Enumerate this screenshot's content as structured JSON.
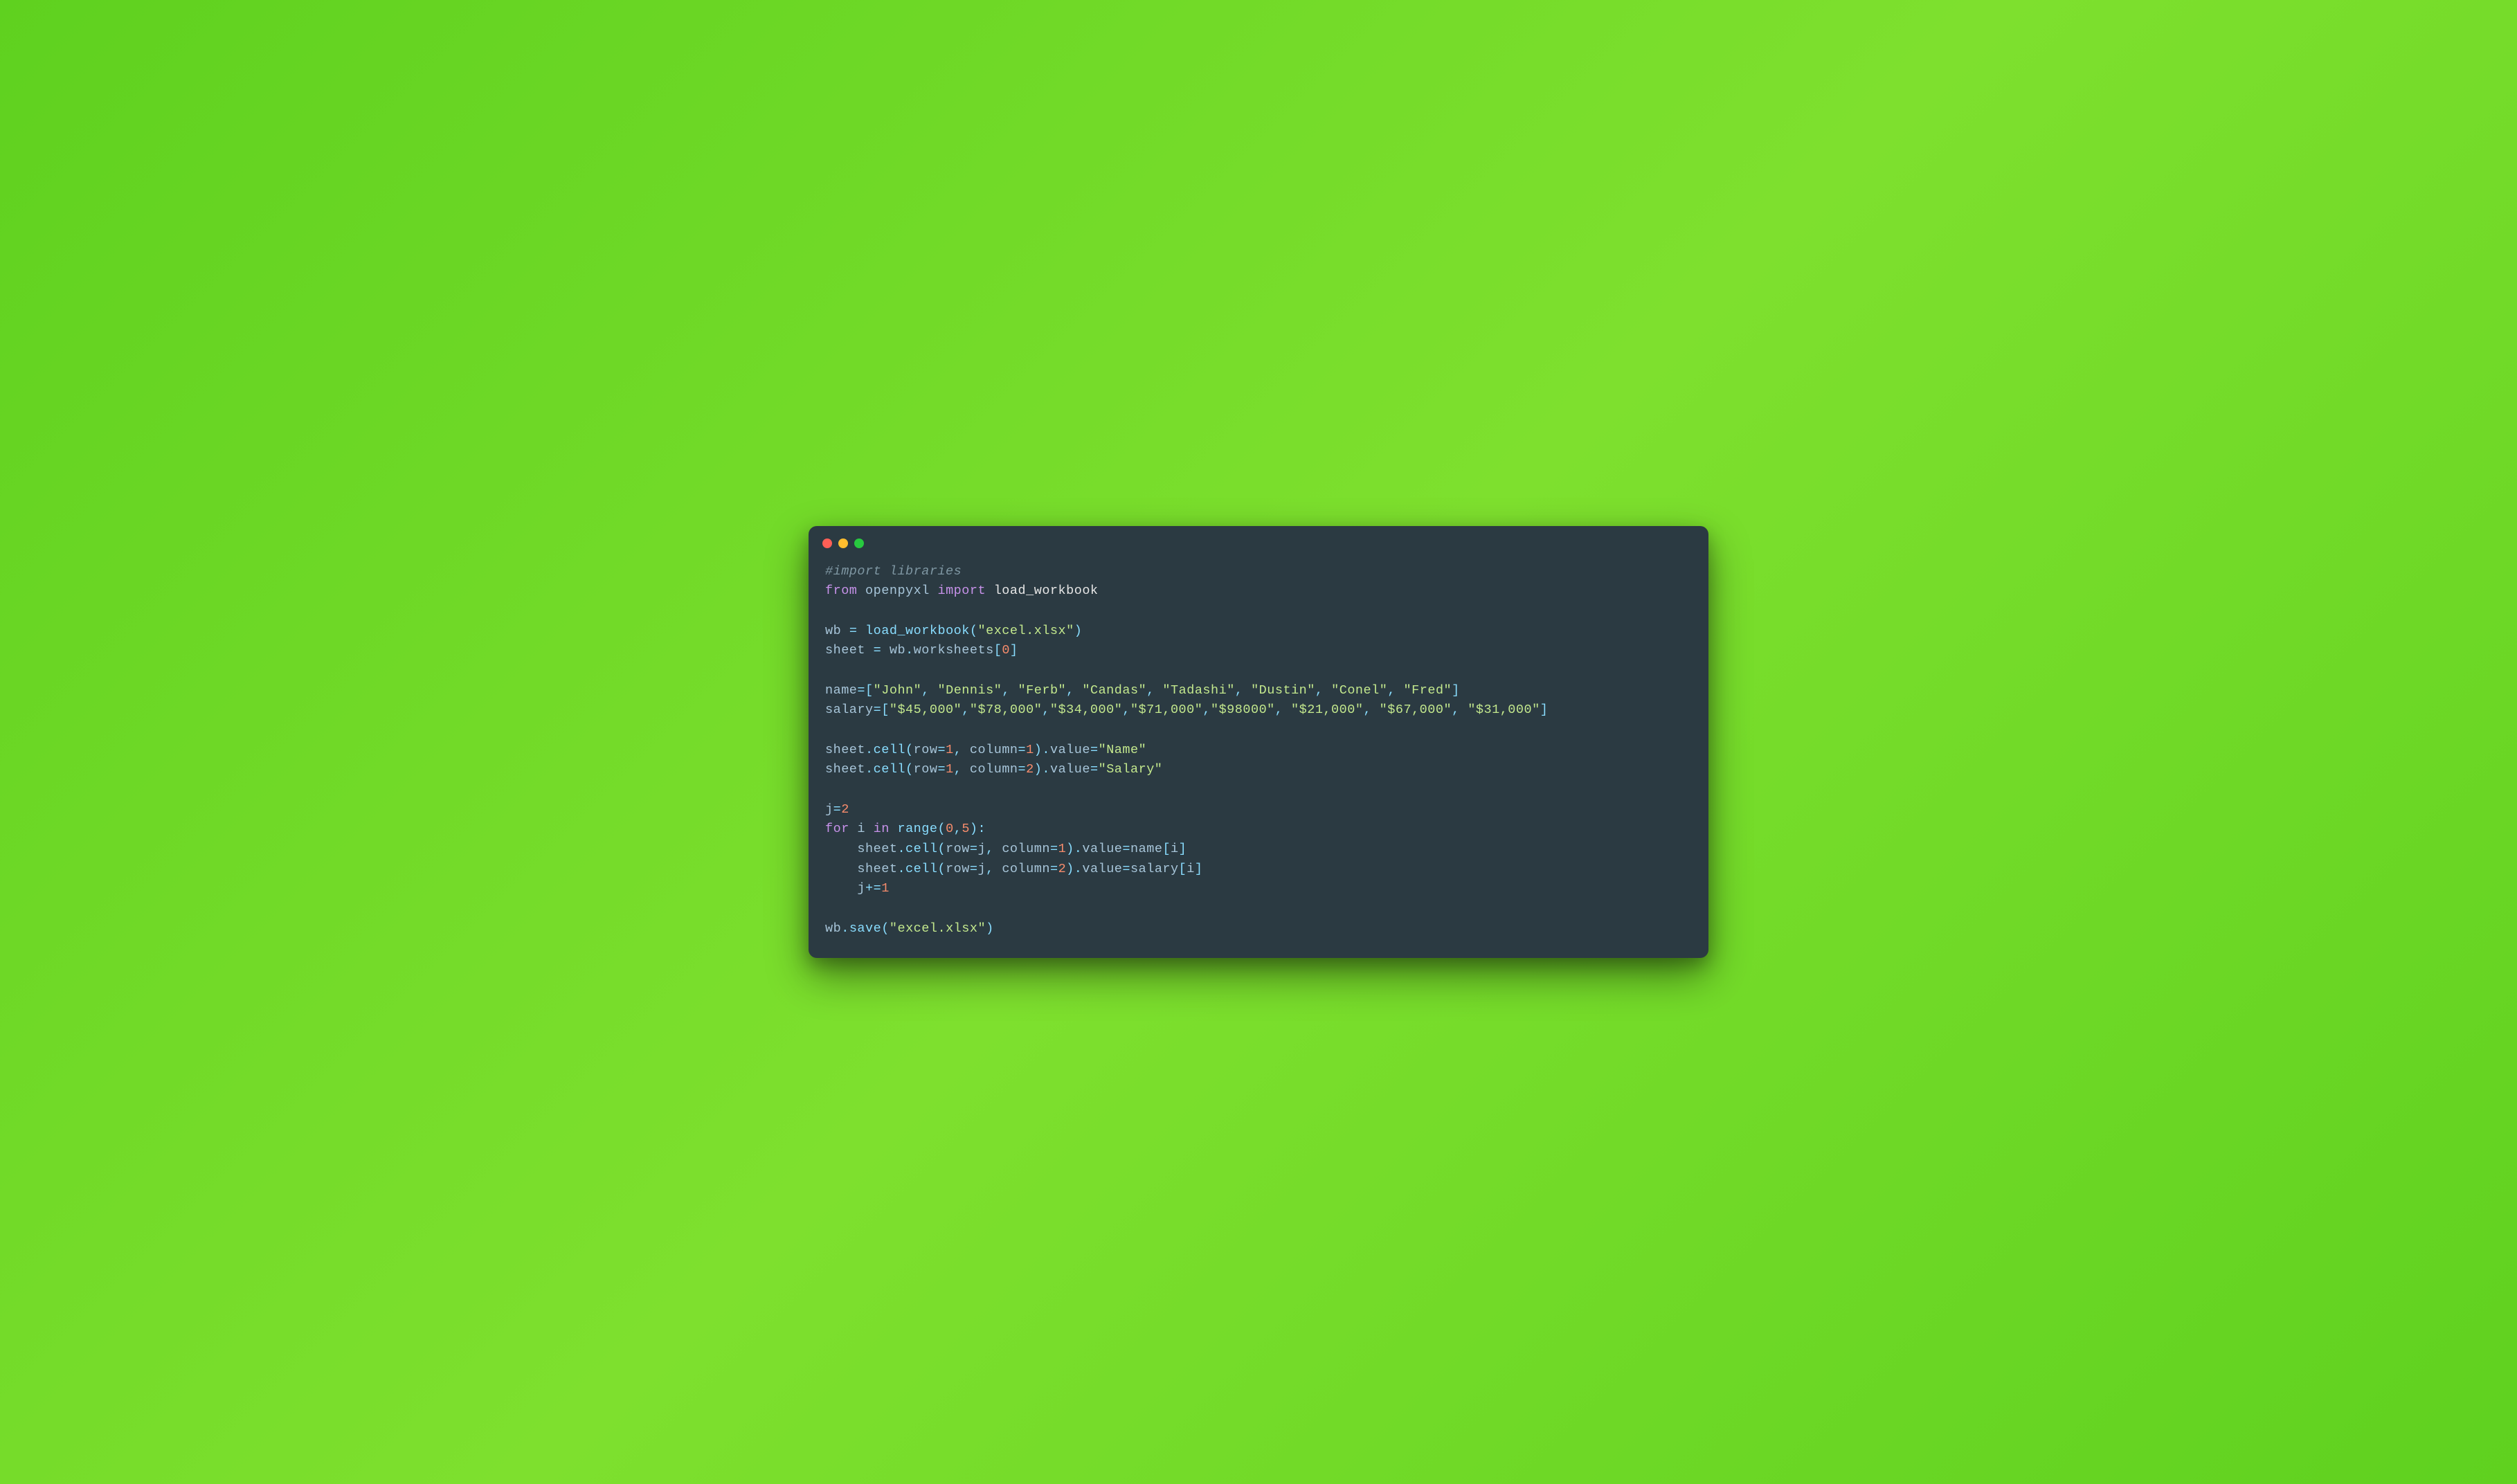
{
  "code": {
    "line1_comment": "#import libraries",
    "line2_from": "from",
    "line2_module": "openpyxl",
    "line2_import": "import",
    "line2_name": "load_workbook",
    "line4_wb": "wb",
    "line4_eq": "=",
    "line4_call": "load_workbook",
    "line4_arg": "\"excel.xlsx\"",
    "line5_sheet": "sheet",
    "line5_eq": "=",
    "line5_wb": "wb",
    "line5_dot": ".",
    "line5_ws": "worksheets",
    "line5_idx_l": "[",
    "line5_idx": "0",
    "line5_idx_r": "]",
    "line7_name": "name",
    "line7_eq": "=",
    "line7_l": "[",
    "line7_v1": "\"John\"",
    "line7_v2": "\"Dennis\"",
    "line7_v3": "\"Ferb\"",
    "line7_v4": "\"Candas\"",
    "line7_v5": "\"Tadashi\"",
    "line7_v6": "\"Dustin\"",
    "line7_v7": "\"Conel\"",
    "line7_v8": "\"Fred\"",
    "line7_r": "]",
    "line8_salary": "salary",
    "line8_eq": "=",
    "line8_l": "[",
    "line8_v1": "\"$45,000\"",
    "line8_v2": "\"$78,000\"",
    "line8_v3": "\"$34,000\"",
    "line8_v4": "\"$71,000\"",
    "line8_v5": "\"$98000\"",
    "line8_v6": "\"$21,000\"",
    "line8_v7": "\"$67,000\"",
    "line8_v8": "\"$31,000\"",
    "line8_r": "]",
    "line10_sheet": "sheet",
    "line10_cell": "cell",
    "line10_row": "row",
    "line10_row_v": "1",
    "line10_col": "column",
    "line10_col_v": "1",
    "line10_value": "value",
    "line10_str": "\"Name\"",
    "line11_sheet": "sheet",
    "line11_cell": "cell",
    "line11_row": "row",
    "line11_row_v": "1",
    "line11_col": "column",
    "line11_col_v": "2",
    "line11_value": "value",
    "line11_str": "\"Salary\"",
    "line13_j": "j",
    "line13_eq": "=",
    "line13_v": "2",
    "line14_for": "for",
    "line14_i": "i",
    "line14_in": "in",
    "line14_range": "range",
    "line14_a": "0",
    "line14_b": "5",
    "line15_sheet": "sheet",
    "line15_cell": "cell",
    "line15_row": "row",
    "line15_rowv": "j",
    "line15_col": "column",
    "line15_colv": "1",
    "line15_value": "value",
    "line15_rhs_name": "name",
    "line15_rhs_idx": "i",
    "line16_sheet": "sheet",
    "line16_cell": "cell",
    "line16_row": "row",
    "line16_rowv": "j",
    "line16_col": "column",
    "line16_colv": "2",
    "line16_value": "value",
    "line16_rhs_name": "salary",
    "line16_rhs_idx": "i",
    "line17_j": "j",
    "line17_op": "+=",
    "line17_v": "1",
    "line19_wb": "wb",
    "line19_save": "save",
    "line19_arg": "\"excel.xlsx\""
  }
}
